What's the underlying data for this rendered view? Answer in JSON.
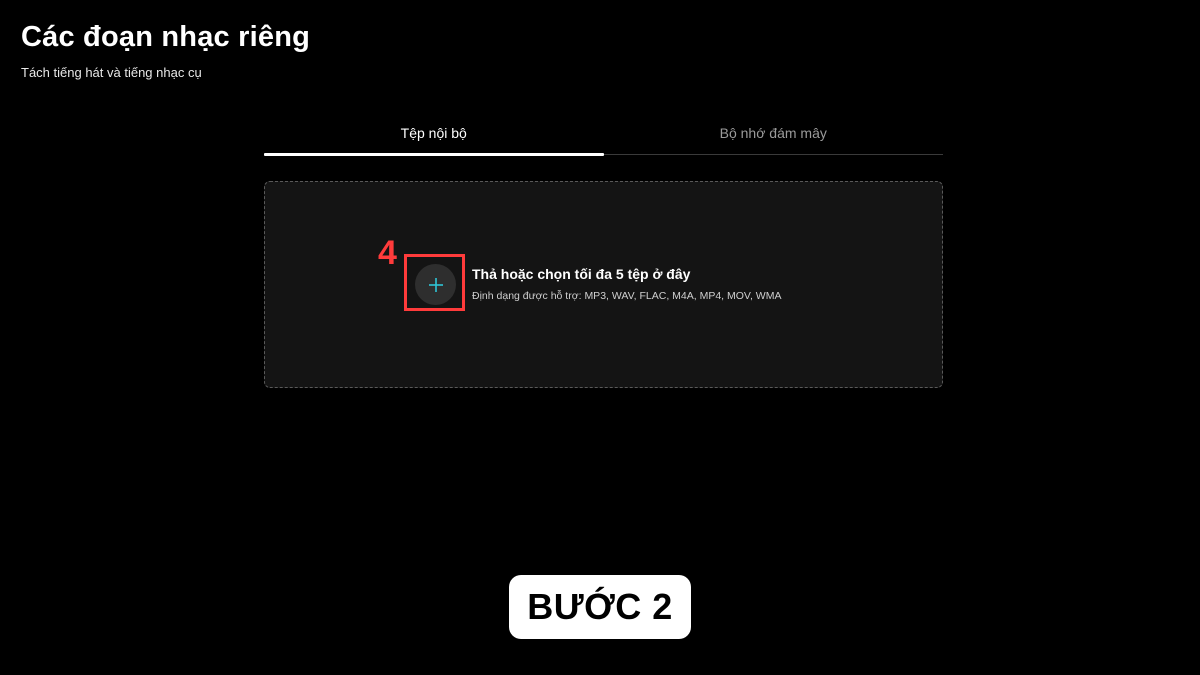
{
  "header": {
    "title": "Các đoạn nhạc riêng",
    "subtitle": "Tách tiếng hát và tiếng nhạc cụ"
  },
  "tabs": [
    {
      "label": "Tệp nội bộ",
      "active": true
    },
    {
      "label": "Bộ nhớ đám mây",
      "active": false
    }
  ],
  "dropzone": {
    "title": "Thả hoặc chọn tối đa 5 tệp ở đây",
    "formats": "Định dạng được hỗ trợ: MP3, WAV, FLAC, M4A, MP4, MOV, WMA",
    "add_icon": "plus-icon"
  },
  "annotation": {
    "step_number": "4",
    "step_label": "BƯỚC 2"
  },
  "colors": {
    "background": "#000000",
    "dropzone_bg": "#141414",
    "highlight": "#ff3b3b",
    "plus_accent": "#2ec4d6"
  }
}
